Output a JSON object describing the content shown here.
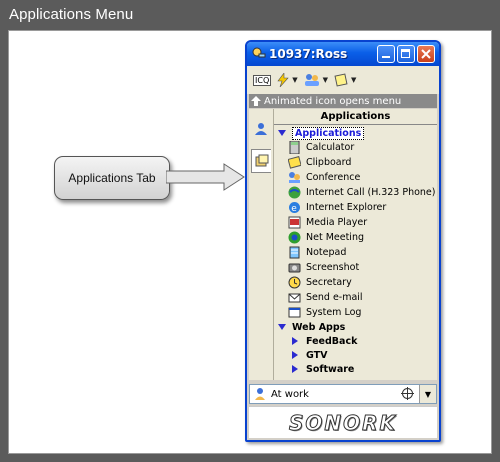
{
  "page": {
    "title": "Applications Menu"
  },
  "callout": {
    "text": "Applications Tab"
  },
  "window": {
    "title": "10937:Ross",
    "toolbar": {
      "first_item_label": "ICQ"
    },
    "hint": "Animated icon opens menu",
    "panel_header": "Applications",
    "tree": {
      "root": "Applications",
      "items": [
        {
          "label": "Calculator",
          "icon": "calculator-icon"
        },
        {
          "label": "Clipboard",
          "icon": "clipboard-icon"
        },
        {
          "label": "Conference",
          "icon": "conference-icon"
        },
        {
          "label": "Internet Call (H.323 Phone)",
          "icon": "internet-call-icon"
        },
        {
          "label": "Internet Explorer",
          "icon": "internet-explorer-icon"
        },
        {
          "label": "Media Player",
          "icon": "media-player-icon"
        },
        {
          "label": "Net Meeting",
          "icon": "net-meeting-icon"
        },
        {
          "label": "Notepad",
          "icon": "notepad-icon"
        },
        {
          "label": "Screenshot",
          "icon": "screenshot-icon"
        },
        {
          "label": "Secretary",
          "icon": "secretary-icon"
        },
        {
          "label": "Send e-mail",
          "icon": "email-icon"
        },
        {
          "label": "System Log",
          "icon": "system-log-icon"
        }
      ],
      "web_apps": {
        "label": "Web Apps",
        "items": [
          "FeedBack",
          "GTV",
          "Software"
        ]
      }
    },
    "status": {
      "label": "At work"
    },
    "logo": "SONORK"
  }
}
